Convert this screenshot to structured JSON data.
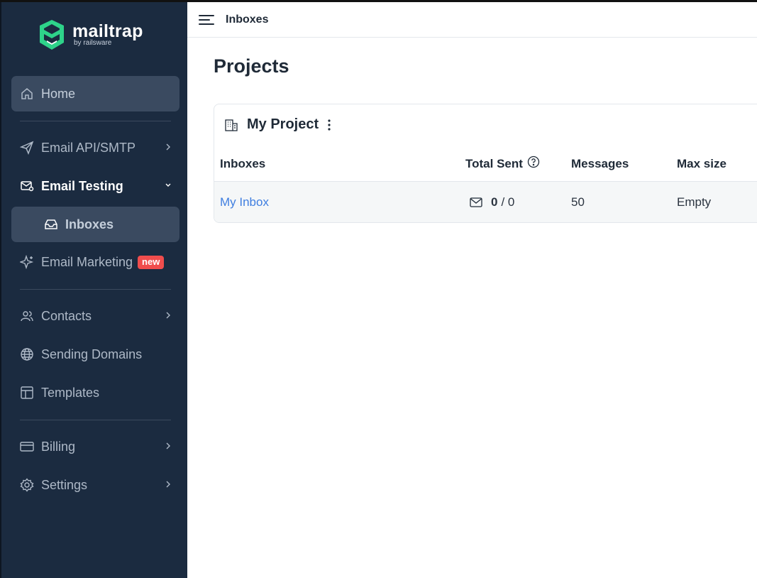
{
  "app": {
    "name": "mailtrap",
    "byline": "by railsware"
  },
  "sidebar": {
    "home": "Home",
    "email_api": "Email API/SMTP",
    "email_testing": "Email Testing",
    "inboxes": "Inboxes",
    "email_marketing": "Email Marketing",
    "new_badge": "new",
    "contacts": "Contacts",
    "sending_domains": "Sending Domains",
    "templates": "Templates",
    "billing": "Billing",
    "settings": "Settings"
  },
  "header": {
    "title": "Inboxes"
  },
  "main": {
    "title": "Projects",
    "project": {
      "name": "My Project",
      "columns": {
        "inboxes": "Inboxes",
        "total_sent": "Total Sent",
        "messages": "Messages",
        "max_size": "Max size"
      },
      "rows": [
        {
          "name": "My Inbox",
          "sent": "0",
          "sent_limit": "/ 0",
          "messages": "50",
          "max_size": "Empty"
        }
      ]
    }
  },
  "colors": {
    "sidebar_bg": "#1b2b40",
    "active_bg": "#3a4a60",
    "link": "#3f7ee0",
    "badge": "#f04d4d",
    "logo_green": "#2ed38a"
  },
  "icons": [
    "house-icon",
    "paper-plane-icon",
    "mail-check-icon",
    "inbox-tray-icon",
    "sparkle-icon",
    "users-icon",
    "globe-icon",
    "template-layout-icon",
    "credit-card-icon",
    "gear-icon",
    "menu-icon",
    "building-icon",
    "kebab-icon",
    "help-circle-icon",
    "envelope-icon"
  ]
}
